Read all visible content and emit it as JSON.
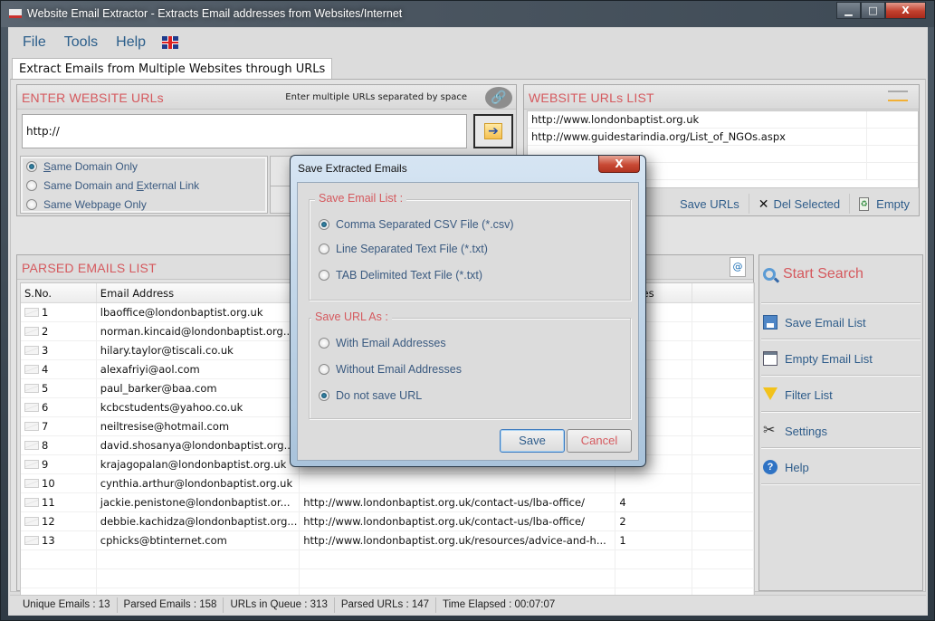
{
  "window": {
    "title": "Website Email Extractor - Extracts Email addresses from Websites/Internet",
    "controls": {
      "minimize": "▁",
      "maximize": "□",
      "close": "X"
    }
  },
  "menu": {
    "items": [
      "File",
      "Tools",
      "Help"
    ],
    "language_icon": "uk-flag-icon"
  },
  "tab": {
    "label": "Extract Emails from Multiple Websites through URLs"
  },
  "enter_urls": {
    "title": "ENTER WEBSITE URLs",
    "hint": "Enter multiple URLs separated by space",
    "input_value": "http://",
    "link_icon": "🔗",
    "go_icon": "➔"
  },
  "scope_options": [
    {
      "label_prefix": "",
      "accel": "S",
      "label_rest": "ame Domain Only",
      "selected": true
    },
    {
      "label_prefix": "Same Domain and ",
      "accel": "E",
      "label_rest": "xternal Link",
      "selected": false
    },
    {
      "label_prefix": "Same Webpage Only",
      "accel": "",
      "label_rest": "",
      "selected": false
    }
  ],
  "url_list": {
    "title": "WEBSITE URLs LIST",
    "items": [
      "http://www.londonbaptist.org.uk",
      "http://www.guidestarindia.org/List_of_NGOs.aspx",
      "",
      ""
    ],
    "toolbar": {
      "save": "Save URLs",
      "delete": "Del Selected",
      "empty": "Empty",
      "delete_icon": "✕",
      "empty_icon": "♻"
    }
  },
  "parsed_emails": {
    "title": "PARSED EMAILS LIST",
    "export_icon": "@",
    "columns": [
      "S.No.",
      "Email Address",
      "",
      "rences",
      ""
    ],
    "rows": [
      {
        "sno": "1",
        "email": "lbaoffice@londonbaptist.org.uk",
        "url": "",
        "count": ""
      },
      {
        "sno": "2",
        "email": "norman.kincaid@londonbaptist.org....",
        "url": "",
        "count": ""
      },
      {
        "sno": "3",
        "email": "hilary.taylor@tiscali.co.uk",
        "url": "",
        "count": ""
      },
      {
        "sno": "4",
        "email": "alexafriyi@aol.com",
        "url": "",
        "count": ""
      },
      {
        "sno": "5",
        "email": "paul_barker@baa.com",
        "url": "",
        "count": ""
      },
      {
        "sno": "6",
        "email": "kcbcstudents@yahoo.co.uk",
        "url": "",
        "count": ""
      },
      {
        "sno": "7",
        "email": "neiltresise@hotmail.com",
        "url": "",
        "count": ""
      },
      {
        "sno": "8",
        "email": "david.shosanya@londonbaptist.org...",
        "url": "",
        "count": ""
      },
      {
        "sno": "9",
        "email": "krajagopalan@londonbaptist.org.uk",
        "url": "",
        "count": ""
      },
      {
        "sno": "10",
        "email": "cynthia.arthur@londonbaptist.org.uk",
        "url": "",
        "count": ""
      },
      {
        "sno": "11",
        "email": "jackie.penistone@londonbaptist.or...",
        "url": "http://www.londonbaptist.org.uk/contact-us/lba-office/",
        "count": "4"
      },
      {
        "sno": "12",
        "email": "debbie.kachidza@londonbaptist.org...",
        "url": "http://www.londonbaptist.org.uk/contact-us/lba-office/",
        "count": "2"
      },
      {
        "sno": "13",
        "email": "cphicks@btinternet.com",
        "url": "http://www.londonbaptist.org.uk/resources/advice-and-h...",
        "count": "1"
      }
    ]
  },
  "side_actions": {
    "start_search": "Start Search",
    "items": [
      "Save Email List",
      "Empty Email List",
      "Filter List",
      "Settings",
      "Help"
    ]
  },
  "status": {
    "unique_emails": "Unique Emails :  13",
    "parsed_emails": "Parsed Emails :  158",
    "urls_in_queue": "URLs in Queue :  313",
    "parsed_urls": "Parsed URLs :  147",
    "time_elapsed": "Time Elapsed :  00:07:07"
  },
  "dialog": {
    "title": "Save Extracted Emails",
    "close": "X",
    "email_group": {
      "title": "Save Email List :",
      "options": [
        {
          "label": "Comma Separated CSV File (*.csv)",
          "selected": true
        },
        {
          "label": "Line Separated Text File (*.txt)",
          "selected": false
        },
        {
          "label": "TAB Delimited Text File (*.txt)",
          "selected": false
        }
      ]
    },
    "url_group": {
      "title": "Save URL As :",
      "options": [
        {
          "label": "With Email Addresses",
          "selected": false
        },
        {
          "label": "Without Email Addresses",
          "selected": false
        },
        {
          "label": "Do not save URL",
          "selected": true
        }
      ]
    },
    "save": "Save",
    "cancel": "Cancel"
  },
  "colors": {
    "accent_red": "#d5595e",
    "link_blue": "#2e5c8a",
    "radio_text": "#3a5a80"
  }
}
